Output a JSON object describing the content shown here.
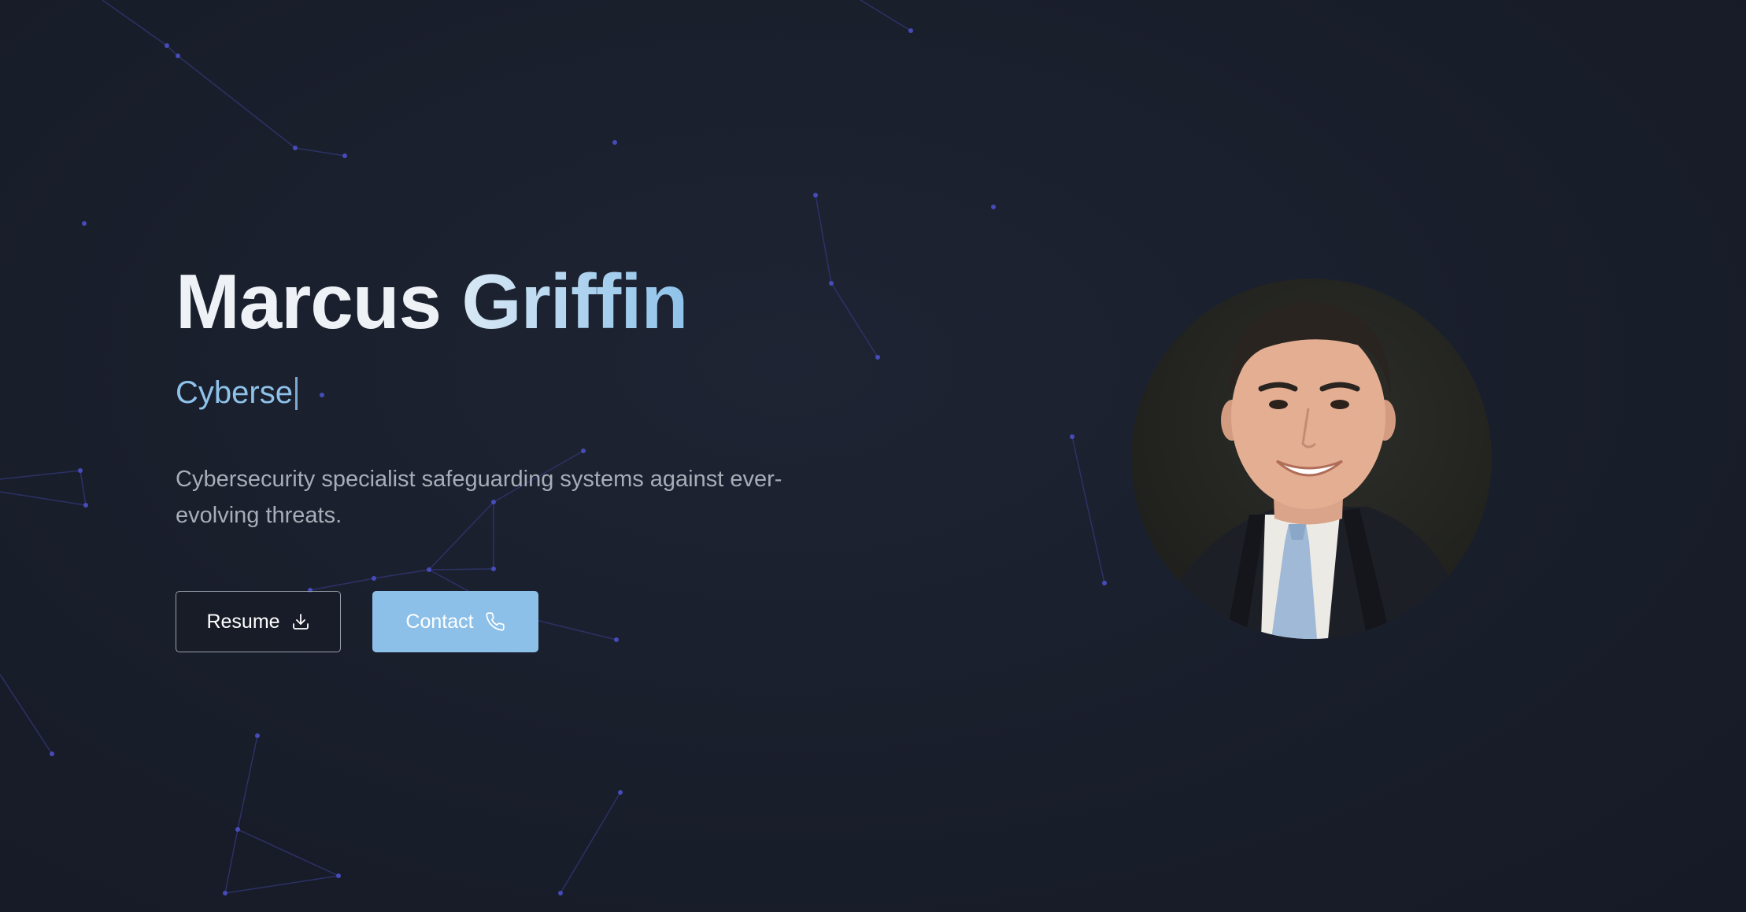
{
  "hero": {
    "name_first": "Marcus",
    "name_last": "Griffin",
    "role_typed": "Cyberse",
    "bio": "Cybersecurity specialist safeguarding systems against ever-evolving threats."
  },
  "buttons": {
    "resume_label": "Resume",
    "contact_label": "Contact"
  },
  "icons": {
    "resume": "download-icon",
    "contact": "phone-icon"
  },
  "colors": {
    "background": "#191e2b",
    "accent": "#8cc0e9",
    "name_text": "#eef1f5",
    "body_text": "#a8adb7",
    "network_line": "#3a3f8a",
    "network_node": "#4b50c8"
  }
}
